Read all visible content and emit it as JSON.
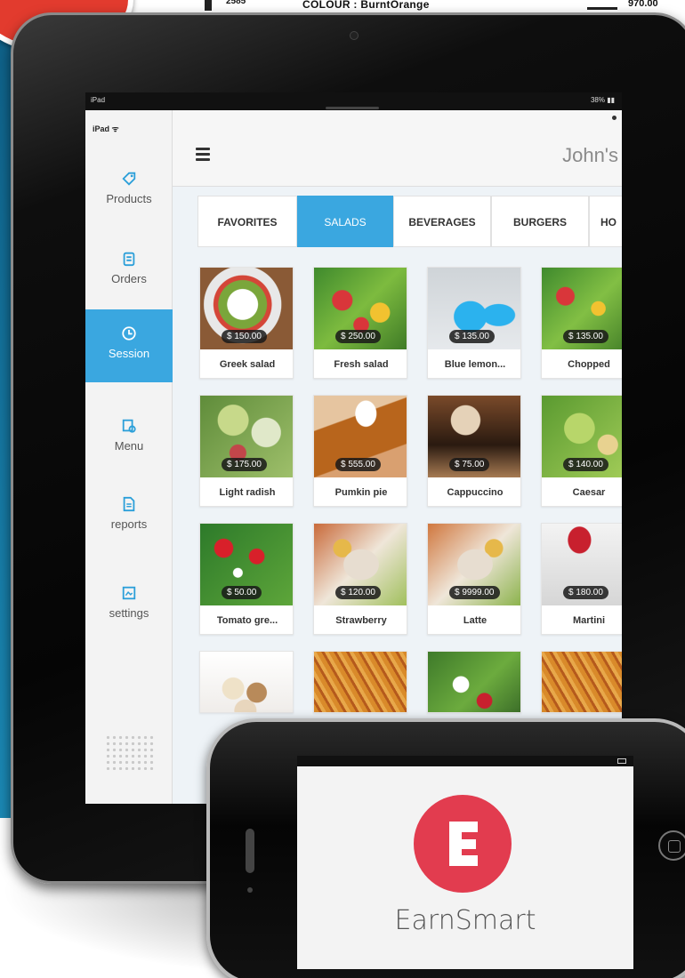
{
  "background": {
    "top_text": "COLOUR : BurntOrange",
    "top_left_text": "2585",
    "top_right_text": "970.00"
  },
  "ipad": {
    "status_bar": {
      "left": "iPad",
      "right": "38% ▮▮"
    },
    "sidebar": {
      "device_label": "iPad",
      "items": [
        {
          "label": "Products",
          "icon": "tag-icon",
          "active": false
        },
        {
          "label": "Orders",
          "icon": "clipboard-icon",
          "active": false
        },
        {
          "label": "Session",
          "icon": "clock-icon",
          "active": true
        },
        {
          "label": "Menu",
          "icon": "menu-document-icon",
          "active": false
        },
        {
          "label": "reports",
          "icon": "report-icon",
          "active": false
        },
        {
          "label": "settings",
          "icon": "settings-icon",
          "active": false
        }
      ]
    },
    "header": {
      "store_name": "John's"
    },
    "tabs": [
      {
        "label": "FAVORITES",
        "active": false
      },
      {
        "label": "SALADS",
        "active": true
      },
      {
        "label": "BEVERAGES",
        "active": false
      },
      {
        "label": "BURGERS",
        "active": false
      },
      {
        "label": "HO",
        "active": false
      }
    ],
    "products": [
      [
        {
          "name": "Greek salad",
          "price": "$ 150.00",
          "image": "salad-green"
        },
        {
          "name": "Fresh salad",
          "price": "$ 250.00",
          "image": "fresh"
        },
        {
          "name": "Blue lemon...",
          "price": "$ 135.00",
          "image": "blue"
        },
        {
          "name": "Chopped",
          "price": "$ 135.00",
          "image": "chopped"
        }
      ],
      [
        {
          "name": "Light radish",
          "price": "$ 175.00",
          "image": "radish"
        },
        {
          "name": "Pumkin pie",
          "price": "$ 555.00",
          "image": "pie"
        },
        {
          "name": "Cappuccino",
          "price": "$ 75.00",
          "image": "cappu"
        },
        {
          "name": "Caesar",
          "price": "$ 140.00",
          "image": "caesar"
        }
      ],
      [
        {
          "name": "Tomato gre...",
          "price": "$ 50.00",
          "image": "tomato"
        },
        {
          "name": "Strawberry",
          "price": "$ 120.00",
          "image": "straw"
        },
        {
          "name": "Latte",
          "price": "$ 9999.00",
          "image": "latte"
        },
        {
          "name": "Martini",
          "price": "$ 180.00",
          "image": "martini"
        }
      ],
      [
        {
          "name": "",
          "price": "",
          "image": "icecream"
        },
        {
          "name": "",
          "price": "",
          "image": "fries"
        },
        {
          "name": "",
          "price": "",
          "image": "salad2"
        },
        {
          "name": "",
          "price": "",
          "image": "fries"
        }
      ]
    ]
  },
  "iphone": {
    "app_name": "EarnSmart",
    "logo_letter": "E",
    "logo_color": "#e23c4f"
  },
  "colors": {
    "accent": "#3aa7e0",
    "brand_red": "#e23c4f"
  }
}
